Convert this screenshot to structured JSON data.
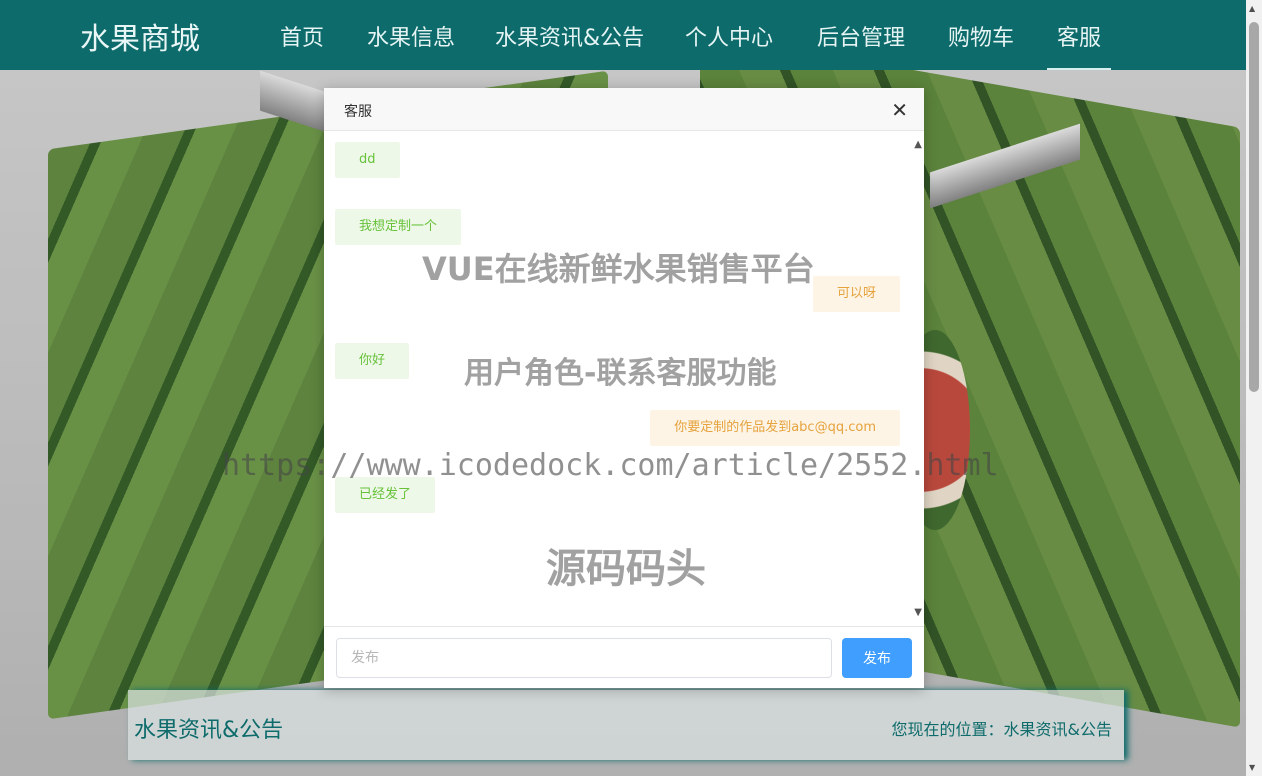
{
  "navbar": {
    "brand": "水果商城",
    "items": [
      {
        "label": "首页"
      },
      {
        "label": "水果信息"
      },
      {
        "label": "水果资讯&公告"
      },
      {
        "label": "个人中心"
      },
      {
        "label": "后台管理"
      },
      {
        "label": "购物车"
      },
      {
        "label": "客服"
      }
    ],
    "active": "客服"
  },
  "breadcrumb": {
    "title": "水果资讯&公告",
    "location": "您现在的位置：水果资讯&公告"
  },
  "dialog": {
    "title": "客服",
    "close_icon": "close-icon",
    "messages": [
      {
        "side": "user",
        "text": "dd"
      },
      {
        "side": "user",
        "text": "我想定制一个"
      },
      {
        "side": "staff",
        "text": "可以呀"
      },
      {
        "side": "user",
        "text": "你好"
      },
      {
        "side": "staff",
        "text": "你要定制的作品发到abc@qq.com"
      },
      {
        "side": "user",
        "text": "已经发了"
      }
    ],
    "input": {
      "placeholder": "发布",
      "value": ""
    },
    "send_label": "发布"
  },
  "watermarks": [
    "VUE在线新鲜水果销售平台",
    "用户角色-联系客服功能",
    "https://www.icodedock.com/article/2552.html",
    "源码码头"
  ],
  "colors": {
    "nav": "#0e6b6b",
    "user_bubble": "#eef8e9",
    "user_text": "#67c23a",
    "staff_bubble": "#fdf4e6",
    "staff_text": "#e6a23c",
    "send_button": "#409eff"
  }
}
